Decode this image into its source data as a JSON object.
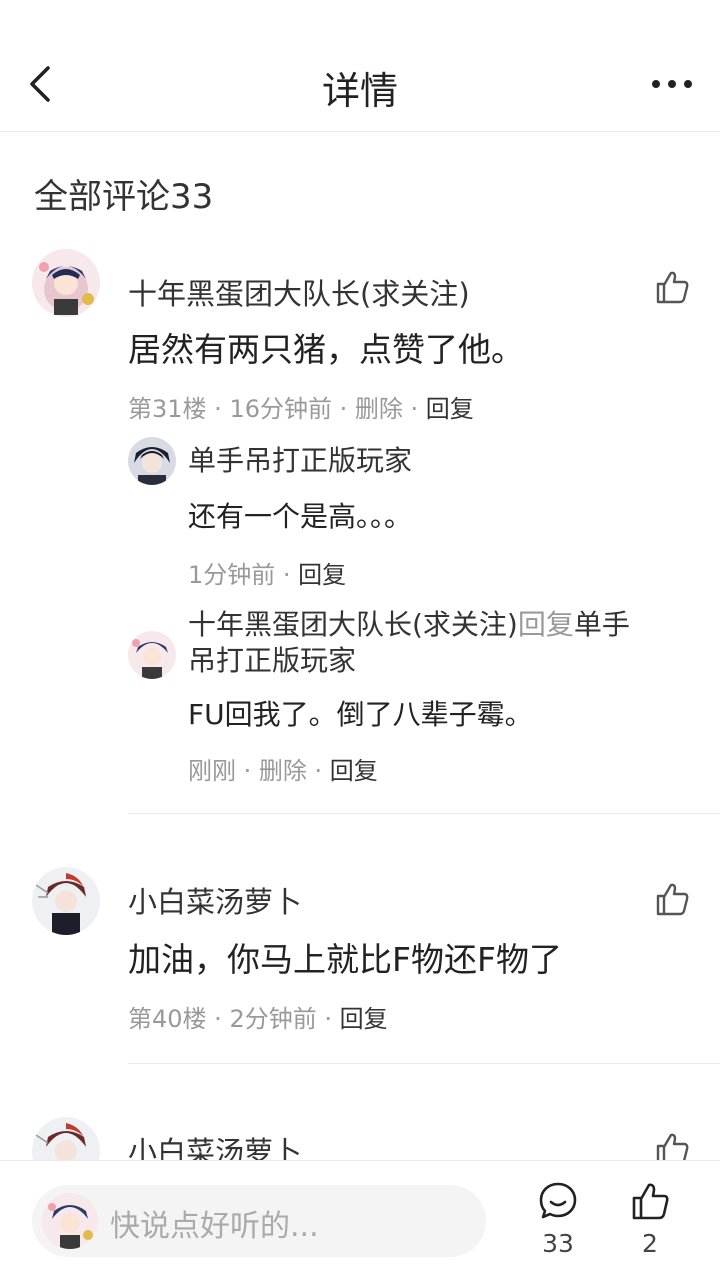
{
  "header": {
    "title": "详情",
    "back_icon": "chevron-left-icon",
    "more_icon": "more-horizontal-icon"
  },
  "comments_section": {
    "title": "全部评论33"
  },
  "comments": [
    {
      "user": "十年黑蛋团大队长(求关注)",
      "text": "居然有两只猪，点赞了他。",
      "floor": "第31楼",
      "time": "16分钟前",
      "delete_label": "删除",
      "reply_label": "回复",
      "replies": [
        {
          "user": "单手吊打正版玩家",
          "text": "还有一个是高。。。",
          "time": "1分钟前",
          "reply_label": "回复"
        },
        {
          "user": "十年黑蛋团大队长(求关注)",
          "reply_word": "回复",
          "target_line1": "单手",
          "target_line2": "吊打正版玩家",
          "text": "FU回我了。倒了八辈子霉。",
          "time": "刚刚",
          "delete_label": "删除",
          "reply_label": "回复"
        }
      ]
    },
    {
      "user": "小白菜汤萝卜",
      "text": "加油，你马上就比F物还F物了",
      "floor": "第40楼",
      "time": "2分钟前",
      "reply_label": "回复"
    },
    {
      "user": "小白菜汤萝卜"
    }
  ],
  "bottom_bar": {
    "input_placeholder": "快说点好听的...",
    "comment_count": "33",
    "like_count": "2"
  },
  "separator": " · ",
  "colors": {
    "text_primary": "#222222",
    "text_secondary": "#999999",
    "divider": "#ececec",
    "input_bg": "#f4f4f4"
  }
}
